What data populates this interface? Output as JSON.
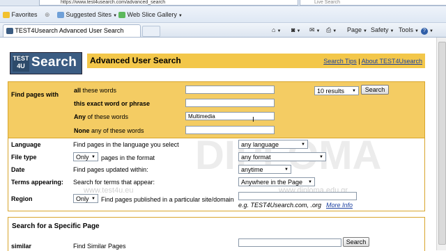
{
  "browser": {
    "address": "https://www.test4usearch.com/advanced_search",
    "search_placeholder": "Live Search",
    "favorites_label": "Favorites",
    "suggested_sites": "Suggested Sites",
    "web_slice_gallery": "Web Slice Gallery",
    "tab_title": "TEST4Usearch Advanced User Search",
    "commands": [
      "Page",
      "Safety",
      "Tools"
    ]
  },
  "header": {
    "logo_top": "TEST",
    "logo_bottom": "4U",
    "logo_word": "Search",
    "title": "Advanced User Search",
    "search_tips": "Search Tips",
    "separator": "|",
    "about": "About TEST4Usearch"
  },
  "find": {
    "label": "Find pages with",
    "rows": [
      {
        "bold": "all",
        "rest": " these words",
        "value": ""
      },
      {
        "bold": "this exact word or phrase",
        "rest": "",
        "value": ""
      },
      {
        "bold": "Any",
        "rest": " of these words",
        "value": "Multimedia"
      },
      {
        "bold": "None",
        "rest": " any of these words",
        "value": ""
      }
    ],
    "results_select": "10 results",
    "search_button": "Search"
  },
  "options": [
    {
      "label": "Language",
      "desc": "Find pages in the language you select",
      "value": "any language"
    },
    {
      "label": "File type",
      "prefix_select": "Only",
      "desc": "pages in the format",
      "value": "any format"
    },
    {
      "label": "Date",
      "desc": "Find pages updated within:",
      "value": "anytime"
    },
    {
      "label": "Terms appearing:",
      "desc": "Search for terms that appear:",
      "value": "Anywhere in the Page"
    },
    {
      "label": "Region",
      "prefix_select": "Only",
      "desc": "Find pages published in a particular site/domain",
      "value": ""
    }
  ],
  "region_hint": "e.g. TEST4Usearch.com, .org",
  "more_info": "More Info",
  "specific": {
    "title": "Search for a Specific Page",
    "similar_label": "similar",
    "similar_desc": "Find Similar Pages",
    "search_button": "Search"
  },
  "watermark": {
    "site1": "www.test4u.eu",
    "site2": "www.diploma.edu.gr",
    "big": "DIPLOMA"
  }
}
